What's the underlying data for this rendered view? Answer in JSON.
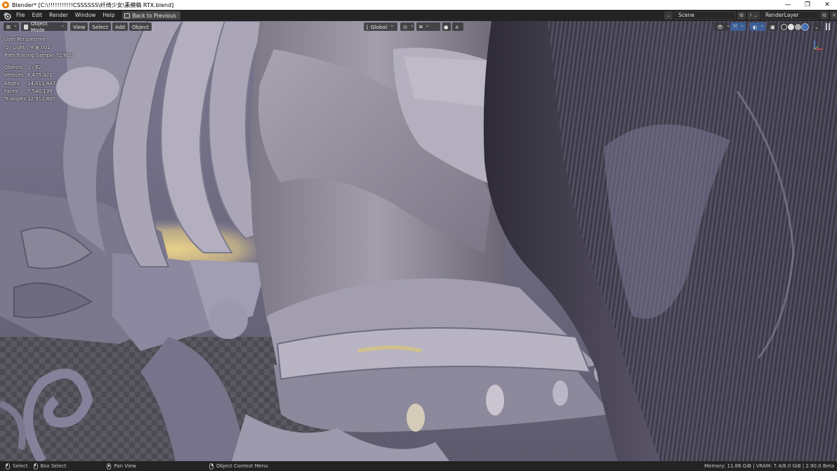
{
  "window": {
    "title": "Blender* [C:\\!!!!!!!!!!!CSSSSSS\\纤绮少女\\素模稿 RTX.blend]",
    "controls": {
      "minimize": "—",
      "maximize": "❐",
      "close": "✕"
    }
  },
  "topbar": {
    "menus": [
      "File",
      "Edit",
      "Render",
      "Window",
      "Help"
    ],
    "back_button": "Back to Previous",
    "scene": "Scene",
    "render_layer": "RenderLayer"
  },
  "viewport_header": {
    "mode": "Object Mode",
    "menus": [
      "View",
      "Select",
      "Add",
      "Object"
    ],
    "transform_orientation": "Global"
  },
  "overlay": {
    "view_name": "User Perspective",
    "collection": "(2) Light | 头发.001",
    "render_progress": "Path Tracing Sample 72/800",
    "stats": [
      {
        "label": "Objects",
        "value": "1 / 62"
      },
      {
        "label": "Vertices",
        "value": "6,475,421"
      },
      {
        "label": "Edges",
        "value": "14,011,447"
      },
      {
        "label": "Faces",
        "value": "7,540,139"
      },
      {
        "label": "Triangles",
        "value": "12,912,805"
      }
    ]
  },
  "statusbar": {
    "items": [
      "Select",
      "Box Select",
      "Pan View",
      "Object Context Menu"
    ],
    "info": "Memory: 11.86 GiB | VRAM: 7.4/8.0 GiB | 2.90.0 Beta"
  },
  "colors": {
    "ui_bg": "#232323",
    "viewport_clay": "#8e8a9a",
    "accent_blue": "#4772b3",
    "blender_orange": "#e87d0d"
  }
}
